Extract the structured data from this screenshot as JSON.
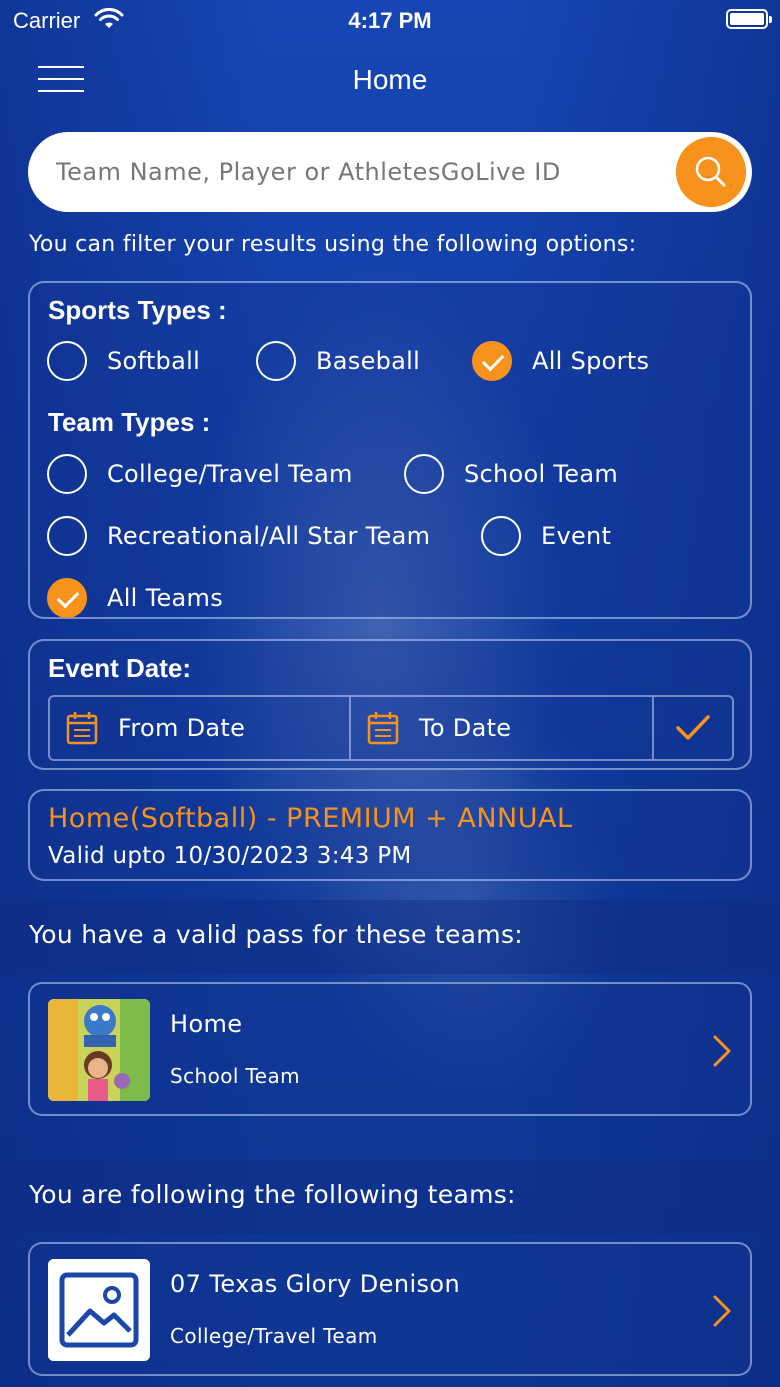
{
  "status_bar": {
    "carrier": "Carrier",
    "time": "4:17 PM"
  },
  "nav": {
    "title": "Home"
  },
  "search": {
    "placeholder": "Team Name, Player or AthletesGoLive ID"
  },
  "filter_hint": "You can filter your results using the following options:",
  "sports": {
    "title": "Sports Types :",
    "options": [
      {
        "label": "Softball",
        "checked": false
      },
      {
        "label": "Baseball",
        "checked": false
      },
      {
        "label": "All Sports",
        "checked": true
      }
    ]
  },
  "teams_filter": {
    "title": "Team Types :",
    "options": [
      {
        "label": "College/Travel Team",
        "checked": false
      },
      {
        "label": "School Team",
        "checked": false
      },
      {
        "label": "Recreational/All Star Team",
        "checked": false
      },
      {
        "label": "Event",
        "checked": false
      },
      {
        "label": "All Teams",
        "checked": true
      }
    ]
  },
  "event_date": {
    "title": "Event Date:",
    "from_label": "From Date",
    "to_label": "To Date"
  },
  "plan": {
    "title": "Home(Softball) - PREMIUM + ANNUAL",
    "valid": "Valid upto 10/30/2023 3:43 PM"
  },
  "pass_section": {
    "heading": "You have a valid pass for these teams:",
    "team": {
      "name": "Home",
      "type": "School Team"
    }
  },
  "follow_section": {
    "heading": "You are following the following teams:",
    "team": {
      "name": "07 Texas Glory Denison",
      "type": "College/Travel Team"
    }
  },
  "colors": {
    "accent": "#f7921c",
    "background": "#1341a8",
    "text": "#ffffff"
  }
}
